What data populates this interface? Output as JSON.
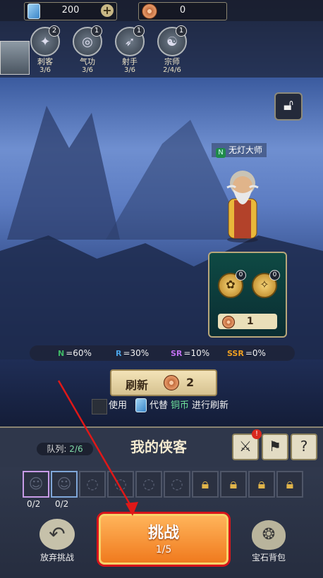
{
  "resources": {
    "tickets": "200",
    "coins": "0"
  },
  "factions": [
    {
      "name": "刺客",
      "count": "3/6",
      "badge": "2"
    },
    {
      "name": "气功",
      "count": "3/6",
      "badge": "1"
    },
    {
      "name": "射手",
      "count": "3/6",
      "badge": "1"
    },
    {
      "name": "宗师",
      "count": "2/4/6",
      "badge": "1"
    }
  ],
  "hero": {
    "rarity": "N",
    "name": "无灯大师"
  },
  "shop": {
    "coin1_badge": "0",
    "coin2_badge": "0",
    "price": "1"
  },
  "rates": [
    {
      "tier": "N",
      "value": "=60%",
      "color": "#3fb866"
    },
    {
      "tier": "R",
      "value": "=30%",
      "color": "#4aa3e6"
    },
    {
      "tier": "SR",
      "value": "=10%",
      "color": "#c070f0"
    },
    {
      "tier": "SSR",
      "value": "=0%",
      "color": "#f0a020"
    }
  ],
  "refresh": {
    "label": "刷新",
    "cost": "2"
  },
  "use_ticket": {
    "prefix": "使用",
    "middle": "代替",
    "highlight": "铜币",
    "suffix": "进行刷新"
  },
  "team": {
    "label": "队列:",
    "count": "2/6",
    "title": "我的侠客",
    "notif_badge": "!"
  },
  "slots": {
    "hero1_count": "0/2",
    "hero2_count": "0/2"
  },
  "actions": {
    "give_up": "放弃挑战",
    "challenge": "挑战",
    "challenge_count": "1/5",
    "gem_bag": "宝石背包"
  }
}
